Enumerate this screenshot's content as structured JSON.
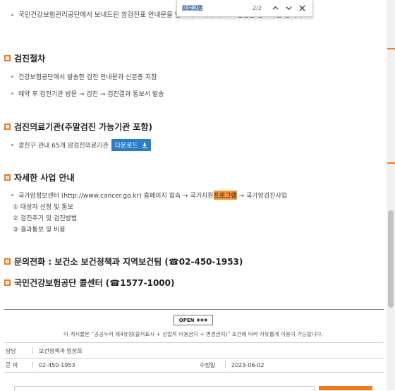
{
  "intro": {
    "text": "국민건강보험관리공단에서 보내드린 암검진표 안내문을 받으시고                                                               에서 무료로 검진을 받으시면 됩니다."
  },
  "sections": {
    "procedure": {
      "title": "검진절차",
      "items": [
        "건강보험공단에서 발송한 검진 안내문과 신분증 지참",
        "예약 후 검진기관 방문 → 검진 → 검진결과 통보서 발송"
      ]
    },
    "institutions": {
      "title": "검진의료기관(주말검진 가능기관 포함)",
      "item": "광진구 관내 65개 암검진의료기관",
      "download_label": "다운로드"
    },
    "details": {
      "title": "자세한 사업 안내",
      "item_prefix": "국가암정보센터 (http://www.cancer.go.kr) 홈페이지 접속 → 국가지원",
      "item_highlight": "프로그램",
      "item_suffix": "→ 국가암검진사업",
      "steps": [
        "① 대상자 선정 및 통보",
        "② 검진주기 및 검진방법",
        "③ 결과통보 및 비용"
      ]
    },
    "inquiry": {
      "title": "문의전화 : 보건소 보건정책과 지역보건팀 (☎02-450-1953)"
    },
    "nhis": {
      "title": "국민건강보험공단 콜센터 (☎1577-1000)"
    }
  },
  "license": {
    "badge": "OPEN",
    "note": "이 게시물은 “공공누리 제4유형(출처표시 + 상업적 이용금지 + 변경금지)” 조건에 따라 자유롭게 이용이 가능합니다."
  },
  "info": {
    "manager_label": "담당",
    "manager_value": "보건정책과 임정희",
    "phone_label": "문 의",
    "phone_value": "02-450-1953",
    "modified_label": "수정일",
    "modified_value": "2023-06-02"
  },
  "findbar": {
    "query": "프로그램",
    "count": "2/2",
    "prev_icon": "chevron-up-icon",
    "next_icon": "chevron-down-icon",
    "close_icon": "close-icon"
  },
  "colors": {
    "accent": "#f07a1e",
    "download": "#2a7dc9",
    "highlight": "#f79533"
  }
}
